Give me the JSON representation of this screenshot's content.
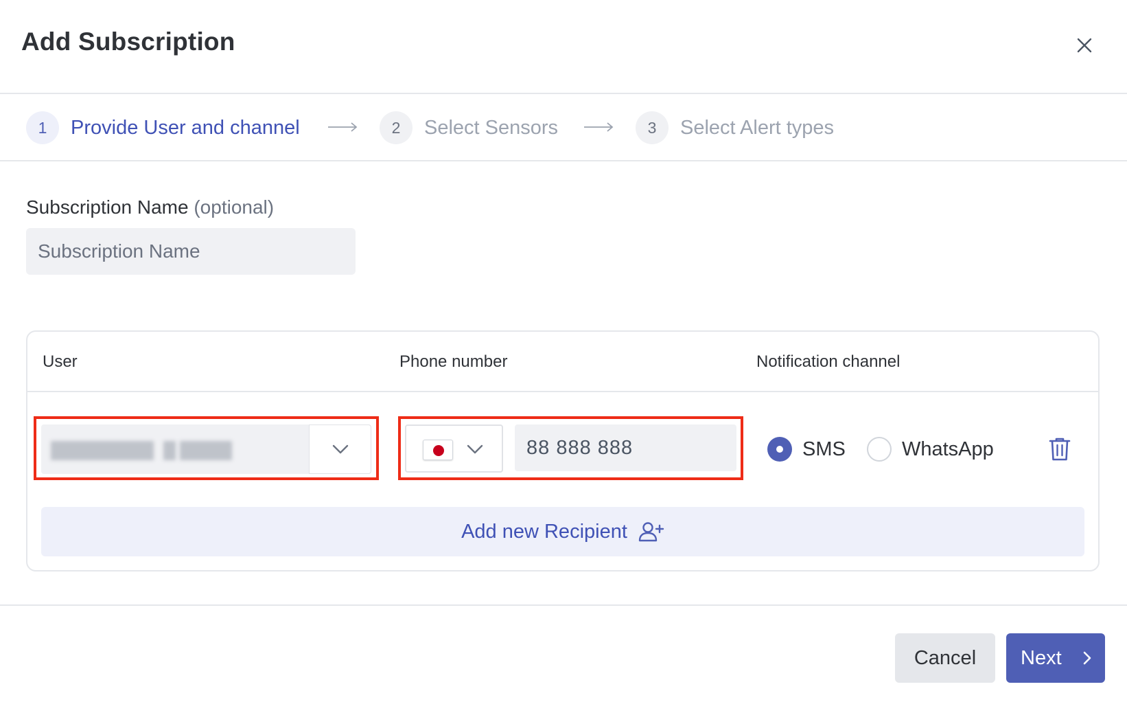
{
  "dialog": {
    "title": "Add Subscription"
  },
  "steps": [
    {
      "number": "1",
      "label": "Provide User and channel",
      "active": true
    },
    {
      "number": "2",
      "label": "Select Sensors",
      "active": false
    },
    {
      "number": "3",
      "label": "Select Alert types",
      "active": false
    }
  ],
  "subscription_name": {
    "label": "Subscription Name",
    "optional": "(optional)",
    "placeholder": "Subscription Name",
    "value": ""
  },
  "recipients_table": {
    "columns": [
      "User",
      "Phone number",
      "Notification channel"
    ],
    "rows": [
      {
        "phone_number": "88 888 888",
        "country_flag": "japan-flag-icon",
        "channels": [
          {
            "label": "SMS",
            "selected": true
          },
          {
            "label": "WhatsApp",
            "selected": false
          }
        ]
      }
    ],
    "add_label": "Add new Recipient"
  },
  "footer": {
    "cancel_label": "Cancel",
    "next_label": "Next"
  },
  "colors": {
    "accent": "#4f5fb5",
    "highlight": "#ee2c17",
    "field_bg": "#f0f1f4"
  }
}
